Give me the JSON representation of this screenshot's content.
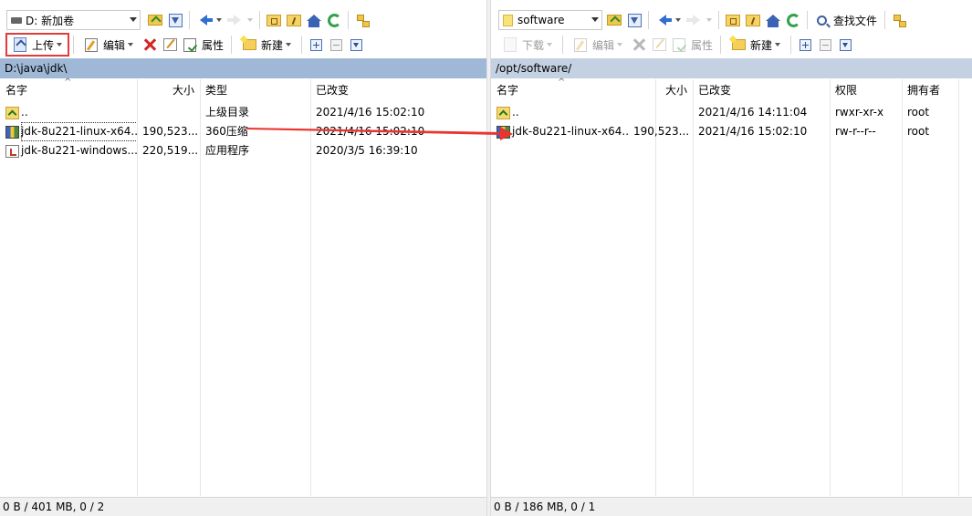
{
  "colors": {
    "accent_highlight": "#e23b3b",
    "path_active": "#9fb8d6",
    "path_inactive": "#c3d1e2"
  },
  "left": {
    "drive": {
      "label": "D: 新加卷",
      "icon": "drive-icon"
    },
    "toolbar": {
      "upload": "上传",
      "edit": "编辑",
      "properties": "属性",
      "new": "新建"
    },
    "path": "D:\\java\\jdk\\",
    "columns": {
      "name": "名字",
      "size": "大小",
      "type": "类型",
      "modified": "已改变"
    },
    "rows": [
      {
        "name": "..",
        "size": "",
        "type": "上级目录",
        "modified": "2021/4/16  15:02:10",
        "icon": "parent-folder-icon"
      },
      {
        "name": "jdk-8u221-linux-x64...",
        "size": "190,523...",
        "type": "360压缩",
        "modified": "2021/4/16  15:02:10",
        "icon": "archive-icon"
      },
      {
        "name": "jdk-8u221-windows...",
        "size": "220,519...",
        "type": "应用程序",
        "modified": "2020/3/5   16:39:10",
        "icon": "application-icon"
      }
    ],
    "status": "0 B / 401 MB,  0 / 2"
  },
  "right": {
    "folder": {
      "label": "software",
      "icon": "folder-icon"
    },
    "find_files": "查找文件",
    "toolbar": {
      "download": "下载",
      "edit": "编辑",
      "properties": "属性",
      "new": "新建"
    },
    "path": "/opt/software/",
    "columns": {
      "name": "名字",
      "size": "大小",
      "modified": "已改变",
      "permissions": "权限",
      "owner": "拥有者"
    },
    "rows": [
      {
        "name": "..",
        "size": "",
        "modified": "2021/4/16  14:11:04",
        "permissions": "rwxr-xr-x",
        "owner": "root",
        "icon": "parent-folder-icon"
      },
      {
        "name": "jdk-8u221-linux-x64...",
        "size": "190,523...",
        "modified": "2021/4/16  15:02:10",
        "permissions": "rw-r--r--",
        "owner": "root",
        "icon": "archive-icon"
      }
    ],
    "status": "0 B / 186 MB,  0 / 1"
  }
}
